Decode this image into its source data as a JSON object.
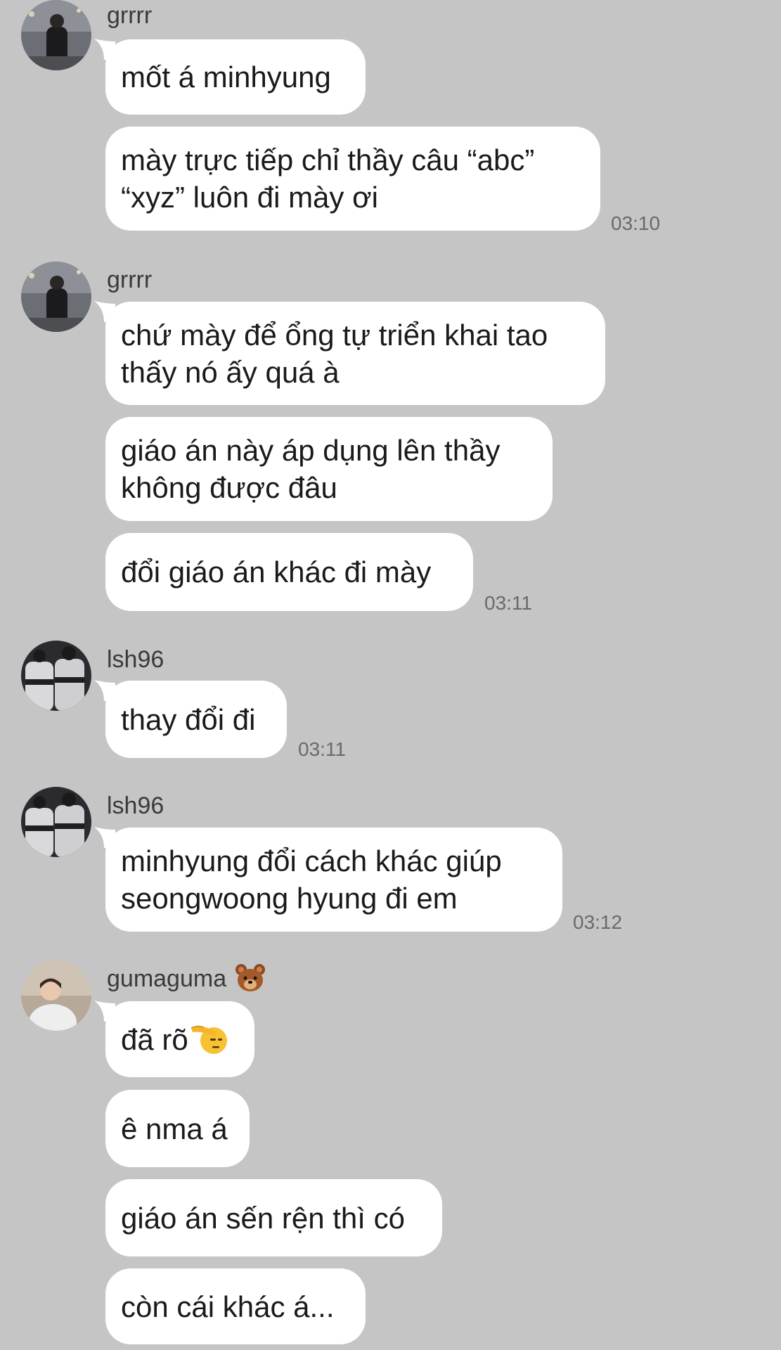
{
  "messages": [
    {
      "sender": "grrrr",
      "bubbles": [
        "mốt á minhyung",
        "mày trực tiếp chỉ thầy câu “abc”\n“xyz” luôn đi mày ơi"
      ],
      "time": "03:10"
    },
    {
      "sender": "grrrr",
      "bubbles": [
        "chứ mày để ổng tự triển khai tao\nthấy nó ấy quá à",
        "giáo án này áp dụng lên thầy\nkhông được đâu",
        "đổi giáo án khác đi mày"
      ],
      "time": "03:11"
    },
    {
      "sender": "lsh96",
      "bubbles": [
        "thay đổi đi"
      ],
      "time": "03:11"
    },
    {
      "sender": "lsh96",
      "bubbles": [
        "minhyung đổi cách khác giúp\nseongwoong hyung đi em"
      ],
      "time": "03:12"
    },
    {
      "sender": "gumaguma",
      "sender_emoji": "bear-face-icon",
      "bubbles": [
        "đã rõ",
        "ê nma á",
        "giáo án sến rện thì có",
        "còn cái khác á..."
      ],
      "first_bubble_emoji": "saluting-face-icon"
    }
  ],
  "colors": {
    "background": "#c5c5c5",
    "bubble": "#ffffff",
    "text": "#1a1a1a",
    "timestamp": "#6a6a6a"
  }
}
